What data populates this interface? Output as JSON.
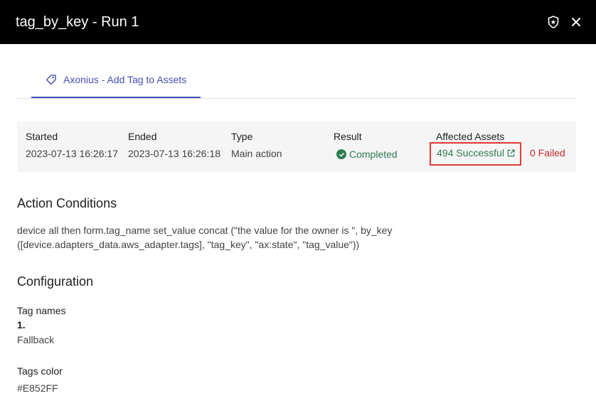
{
  "window": {
    "title": "tag_by_key - Run 1"
  },
  "tabs": [
    {
      "label": "Axonius - Add Tag to Assets",
      "icon": "tag-icon",
      "active": true
    }
  ],
  "summary": {
    "started_label": "Started",
    "started_value": "2023-07-13 16:26:17",
    "ended_label": "Ended",
    "ended_value": "2023-07-13 16:26:18",
    "type_label": "Type",
    "type_value": "Main action",
    "result_label": "Result",
    "result_value": "Completed",
    "affected_label": "Affected Assets",
    "successful": "494 Successful",
    "failed": "0 Failed"
  },
  "conditions": {
    "heading": "Action Conditions",
    "text": "device all then form.tag_name set_value concat (\"the value for the owner is \", by_key ([device.adapters_data.aws_adapter.tags], \"tag_key\", \"ax:state\", \"tag_value\"))"
  },
  "configuration": {
    "heading": "Configuration",
    "tag_names_label": "Tag names",
    "tag_names_index": "1.",
    "tag_names_value": "Fallback",
    "tags_color_label": "Tags color",
    "tags_color_value": "#E852FF"
  },
  "colors": {
    "accent": "#3f51b5",
    "success": "#2e7d4f",
    "danger": "#c62828",
    "highlight": "#e53935"
  }
}
